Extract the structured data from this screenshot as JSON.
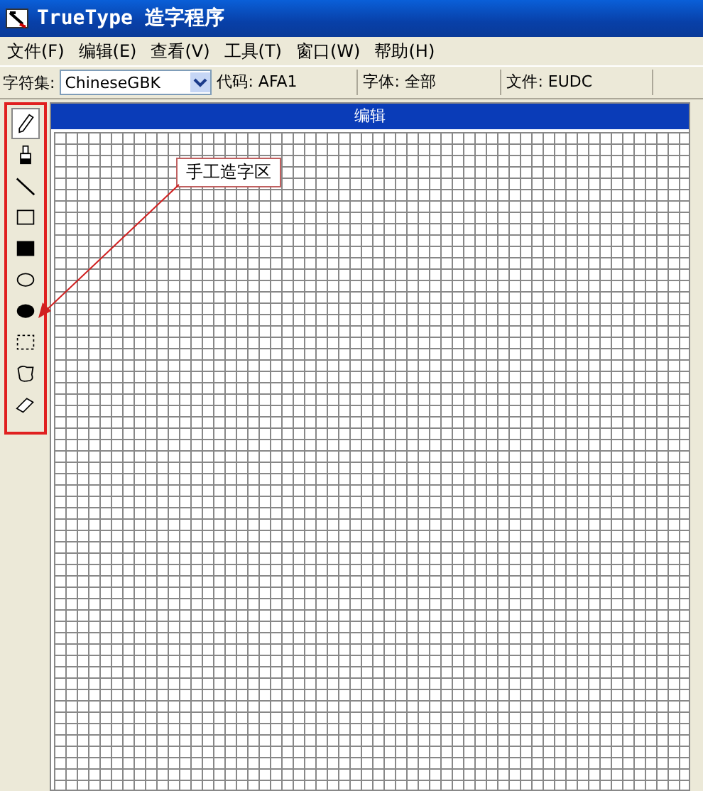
{
  "window": {
    "title": "TrueType 造字程序"
  },
  "menu": [
    "文件(F)",
    "编辑(E)",
    "查看(V)",
    "工具(T)",
    "窗口(W)",
    "帮助(H)"
  ],
  "toolbar": {
    "charset_label": "字符集:",
    "charset_value": "ChineseGBK",
    "code": "代码: AFA1",
    "font": "字体: 全部",
    "file": "文件: EUDC"
  },
  "tools": [
    {
      "kind": "pencil",
      "selected": true
    },
    {
      "kind": "brush",
      "selected": false
    },
    {
      "kind": "line",
      "selected": false
    },
    {
      "kind": "rect",
      "selected": false
    },
    {
      "kind": "filled-rect",
      "selected": false
    },
    {
      "kind": "ellipse",
      "selected": false
    },
    {
      "kind": "filled-ellipse",
      "selected": false
    },
    {
      "kind": "select-rect",
      "selected": false
    },
    {
      "kind": "freeform-select",
      "selected": false
    },
    {
      "kind": "eraser",
      "selected": false
    }
  ],
  "editor": {
    "title": "编辑"
  },
  "annotation": {
    "label": "手工造字区"
  }
}
